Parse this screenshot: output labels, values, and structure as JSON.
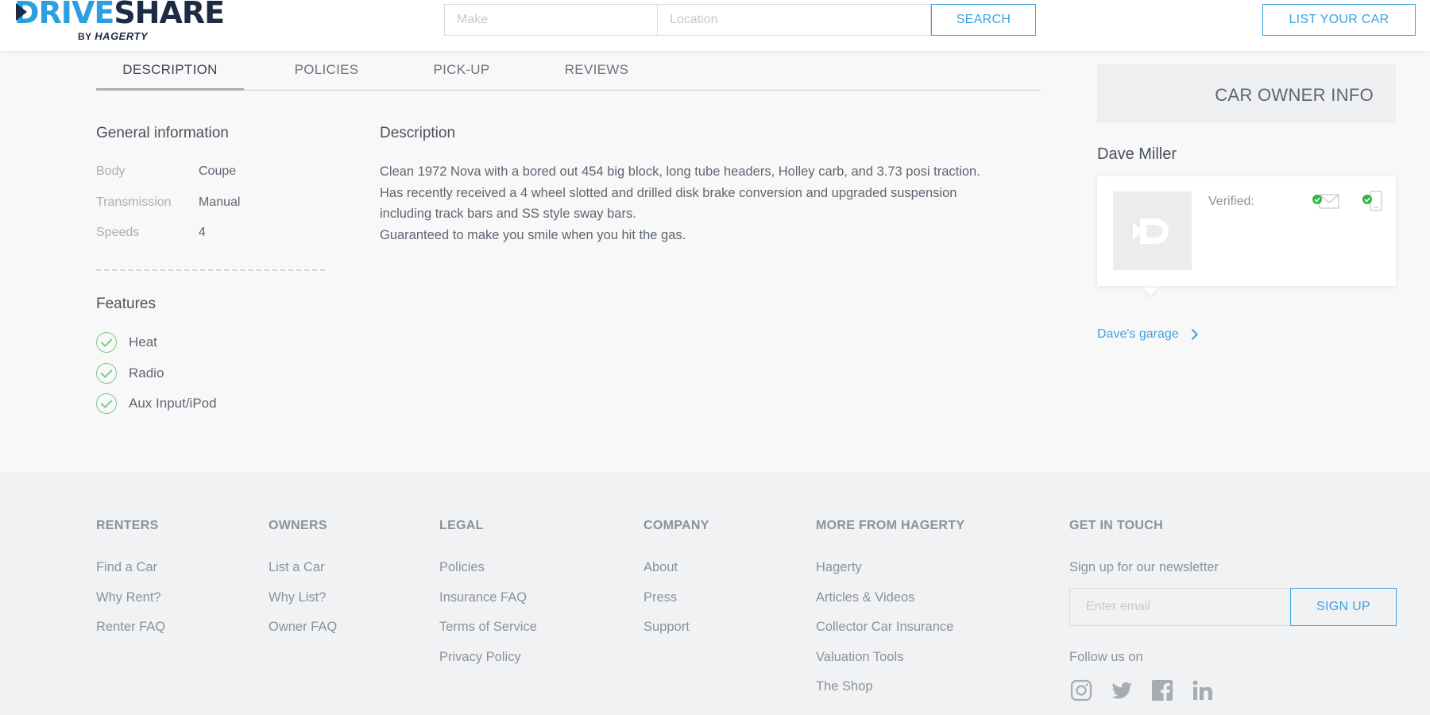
{
  "header": {
    "logo": {
      "word_drive": "DRIVE",
      "word_share": "SHARE",
      "by": "BY",
      "brand": "HAGERTY"
    },
    "search": {
      "make_placeholder": "Make",
      "location_placeholder": "Location",
      "button_label": "SEARCH"
    },
    "list_car_label": "LIST YOUR CAR"
  },
  "tabs": [
    {
      "label": "DESCRIPTION",
      "active": true
    },
    {
      "label": "POLICIES",
      "active": false
    },
    {
      "label": "PICK-UP",
      "active": false
    },
    {
      "label": "REVIEWS",
      "active": false
    }
  ],
  "general": {
    "title": "General information",
    "specs": [
      {
        "label": "Body",
        "value": "Coupe"
      },
      {
        "label": "Transmission",
        "value": "Manual"
      },
      {
        "label": "Speeds",
        "value": "4"
      }
    ]
  },
  "features": {
    "title": "Features",
    "items": [
      "Heat",
      "Radio",
      "Aux Input/iPod"
    ]
  },
  "description": {
    "title": "Description",
    "lines": [
      "Clean 1972 Nova with a bored out 454 big block, long tube headers, Holley carb, and 3.73 posi traction.",
      "Has recently received a 4 wheel slotted and drilled disk brake conversion and upgraded suspension",
      "including track bars and SS style sway bars.",
      "Guaranteed to make you smile when you hit the gas."
    ]
  },
  "owner": {
    "panel_title": "CAR OWNER INFO",
    "name": "Dave Miller",
    "verified_label": "Verified:",
    "verified_icons": [
      "email-verified-icon",
      "phone-verified-icon"
    ],
    "garage_link": "Dave's garage"
  },
  "footer": {
    "columns": [
      {
        "title": "RENTERS",
        "links": [
          "Find a Car",
          "Why Rent?",
          "Renter FAQ"
        ]
      },
      {
        "title": "OWNERS",
        "links": [
          "List a Car",
          "Why List?",
          "Owner FAQ"
        ]
      },
      {
        "title": "LEGAL",
        "links": [
          "Policies",
          "Insurance FAQ",
          "Terms of Service",
          "Privacy Policy"
        ]
      },
      {
        "title": "COMPANY",
        "links": [
          "About",
          "Press",
          "Support"
        ]
      },
      {
        "title": "MORE FROM HAGERTY",
        "links": [
          "Hagerty",
          "Articles & Videos",
          "Collector Car Insurance",
          "Valuation Tools",
          "The Shop"
        ]
      }
    ],
    "contact": {
      "title": "GET IN TOUCH",
      "newsletter_text": "Sign up for our newsletter",
      "email_placeholder": "Enter email",
      "signup_label": "SIGN UP",
      "follow_text": "Follow us on",
      "social_icons": [
        "instagram-icon",
        "twitter-icon",
        "facebook-icon",
        "linkedin-icon"
      ]
    }
  },
  "colors": {
    "accent": "#3ba2df",
    "check_green": "#7ccc86",
    "verified_green": "#2fb34a",
    "logo_navy": "#1d2b44"
  }
}
